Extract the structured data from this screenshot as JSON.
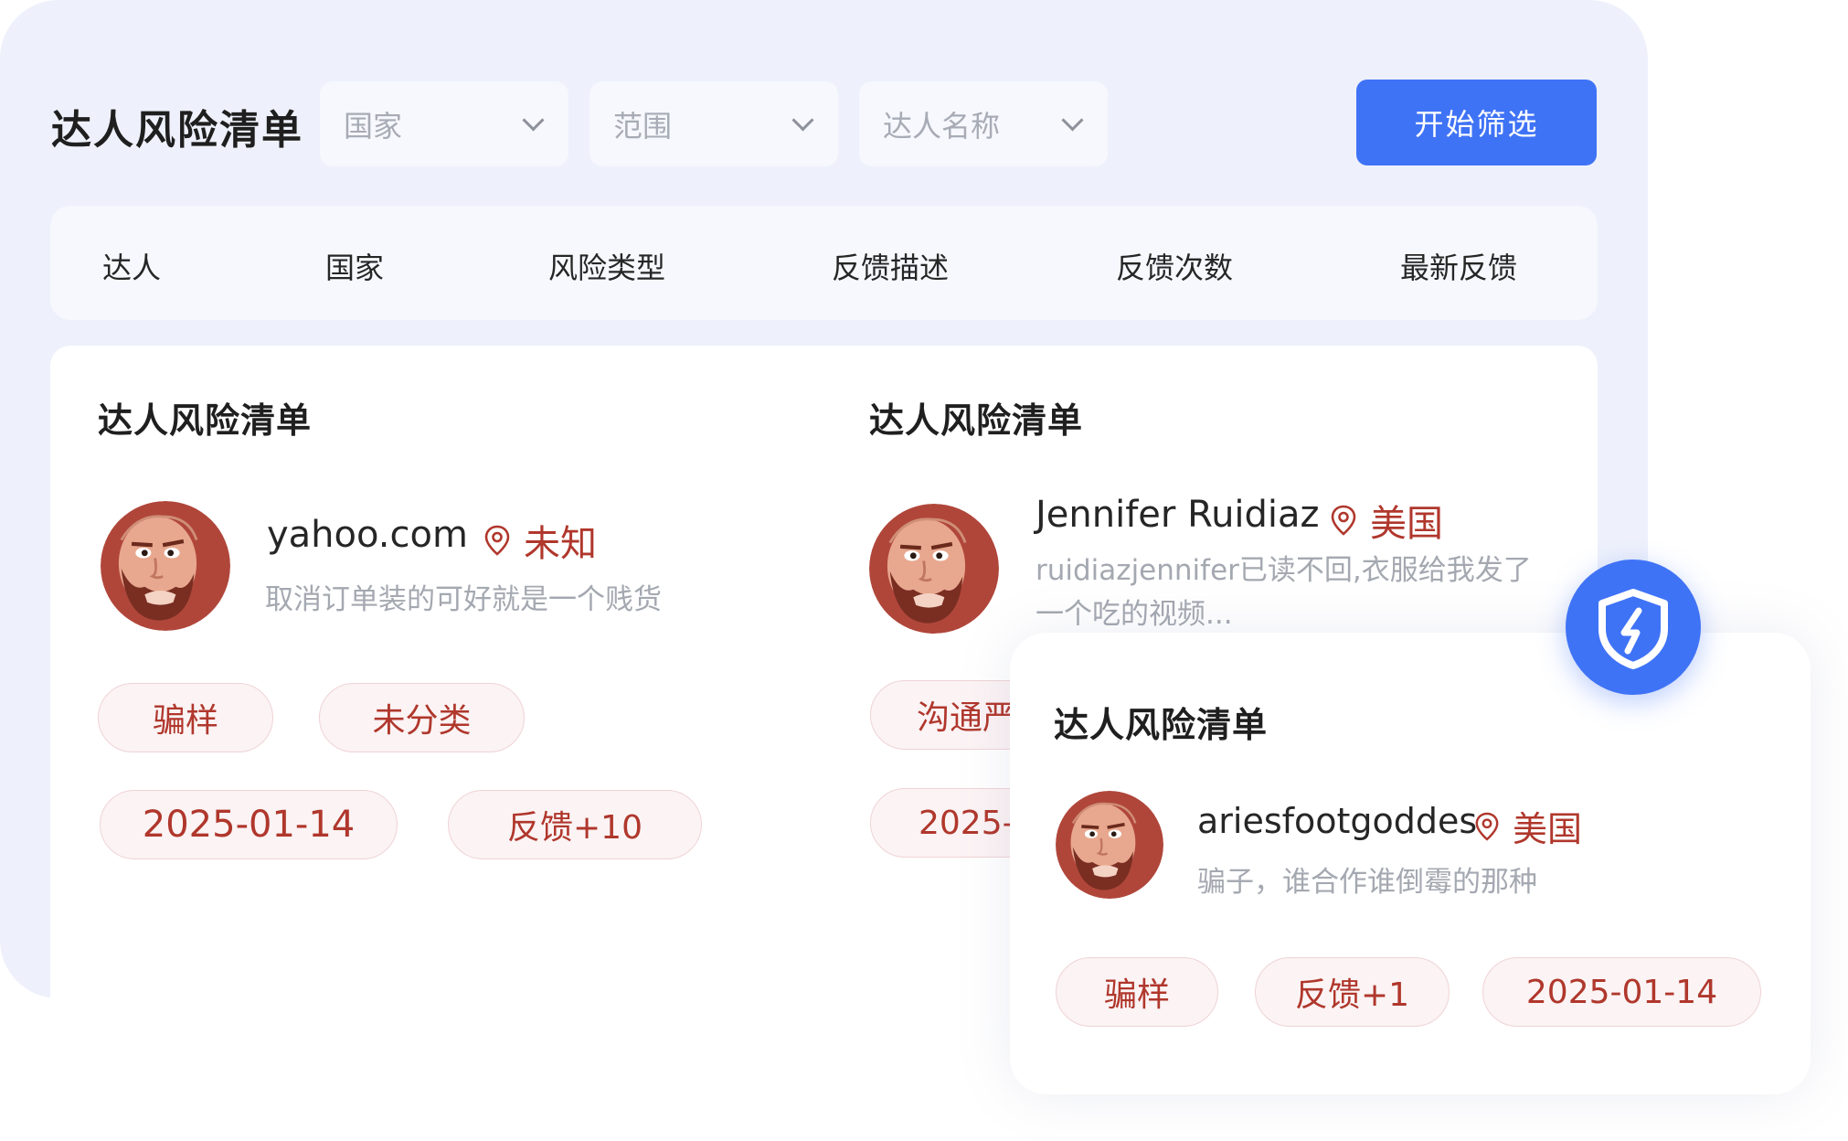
{
  "header": {
    "title": "达人风险清单",
    "filters": [
      {
        "placeholder": "国家"
      },
      {
        "placeholder": "范围"
      },
      {
        "placeholder": "达人名称"
      }
    ],
    "filter_button": "开始筛选"
  },
  "table_header": [
    "达人",
    "国家",
    "风险类型",
    "反馈描述",
    "反馈次数",
    "最新反馈"
  ],
  "cards": [
    {
      "title": "达人风险清单",
      "name": "yahoo.com",
      "location": "未知",
      "description": "取消订单装的可好就是一个贱货",
      "tags": [
        "骗样",
        "未分类",
        "2025-01-14",
        "反馈+10"
      ]
    },
    {
      "title": "达人风险清单",
      "name": "Jennifer Ruidiaz",
      "location": "美国",
      "description_line1": "ruidiazjennifer已读不回,衣服给我发了",
      "description_line2": "一个吃的视频...",
      "tags": [
        "沟通严",
        "2025-"
      ]
    }
  ],
  "popup": {
    "title": "达人风险清单",
    "name": "ariesfootgoddes",
    "location": "美国",
    "description": "骗子，谁合作谁倒霉的那种",
    "tags": [
      "骗样",
      "反馈+1",
      "2025-01-14"
    ]
  },
  "colors": {
    "accent": "#3f73f6",
    "risk_red": "#b0372c",
    "panel_bg": "#eef1fb"
  },
  "icons": {
    "location": "location-pin-icon",
    "shield": "shield-lightning-icon",
    "dropdown": "chevron-down-icon"
  }
}
